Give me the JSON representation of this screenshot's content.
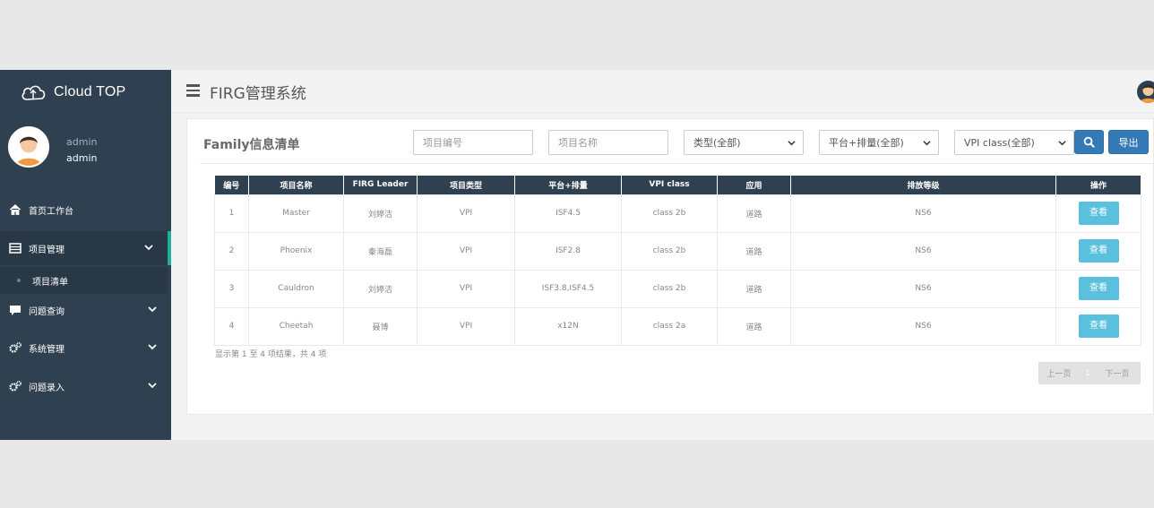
{
  "brand": {
    "name": "Cloud TOP"
  },
  "user": {
    "role": "admin",
    "name": "admin"
  },
  "sidebar": {
    "items": [
      {
        "label": "首页工作台",
        "icon": "home-icon"
      },
      {
        "label": "项目管理",
        "icon": "list-icon"
      },
      {
        "label": "项目清单",
        "icon": "dot-icon"
      },
      {
        "label": "问题查询",
        "icon": "comment-icon"
      },
      {
        "label": "系统管理",
        "icon": "gears-icon"
      },
      {
        "label": "问题录入",
        "icon": "gears-icon"
      }
    ]
  },
  "header": {
    "title": "FIRG管理系统"
  },
  "panel": {
    "title": "Family信息清单",
    "filters": {
      "project_no_placeholder": "项目编号",
      "project_name_placeholder": "项目名称",
      "type_selected": "类型(全部)",
      "platform_selected": "平台+排量(全部)",
      "vpi_selected": "VPI class(全部)"
    },
    "export_label": "导出"
  },
  "table": {
    "columns": [
      "编号",
      "项目名称",
      "FIRG Leader",
      "项目类型",
      "平台+排量",
      "VPI class",
      "应用",
      "排放等级",
      "操作"
    ],
    "rows": [
      {
        "no": "1",
        "name": "Master",
        "leader": "刘婷洁",
        "type": "VPI",
        "platform": "ISF4.5",
        "vpi": "class 2b",
        "app": "道路",
        "emission": "NS6",
        "action": "查看"
      },
      {
        "no": "2",
        "name": "Phoenix",
        "leader": "秦海磊",
        "type": "VPI",
        "platform": "ISF2.8",
        "vpi": "class 2b",
        "app": "道路",
        "emission": "NS6",
        "action": "查看"
      },
      {
        "no": "3",
        "name": "Cauldron",
        "leader": "刘婷洁",
        "type": "VPI",
        "platform": "ISF3.8,ISF4.5",
        "vpi": "class 2b",
        "app": "道路",
        "emission": "NS6",
        "action": "查看"
      },
      {
        "no": "4",
        "name": "Cheetah",
        "leader": "聂博",
        "type": "VPI",
        "platform": "x12N",
        "vpi": "class 2a",
        "app": "道路",
        "emission": "NS6",
        "action": "查看"
      }
    ],
    "summary": "显示第 1 至 4 项结果，共 4 项"
  },
  "pager": {
    "prev": "上一页",
    "current": "1",
    "next": "下一页"
  },
  "colors": {
    "sidebar": "#2f4050",
    "accent": "#1ab394",
    "primary": "#337ab7",
    "info": "#5bc0de"
  }
}
